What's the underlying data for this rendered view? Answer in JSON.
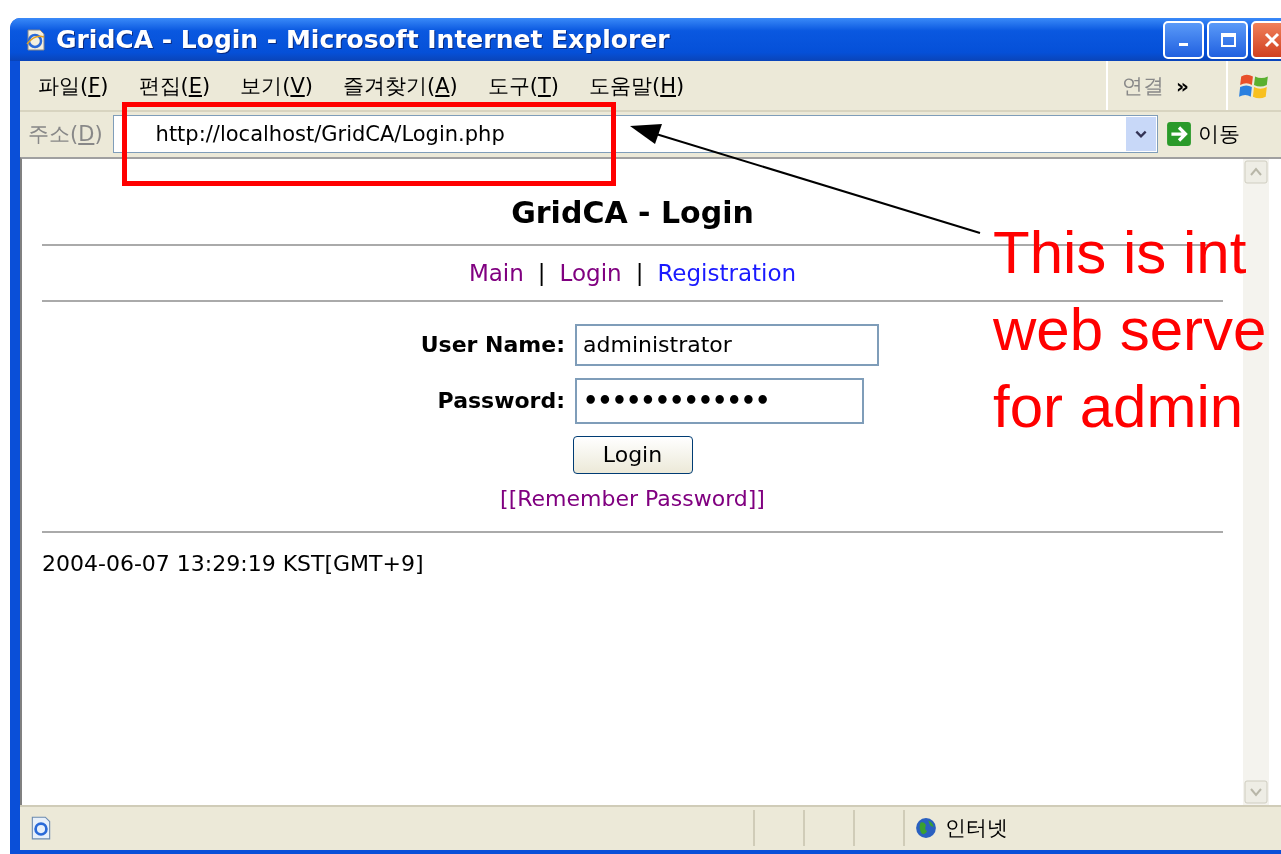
{
  "window": {
    "title": "GridCA - Login - Microsoft Internet Explorer"
  },
  "menu": [
    {
      "before": "파일(",
      "key": "F",
      "after": ")"
    },
    {
      "before": "편집(",
      "key": "E",
      "after": ")"
    },
    {
      "before": "보기(",
      "key": "V",
      "after": ")"
    },
    {
      "before": "즐겨찾기(",
      "key": "A",
      "after": ")"
    },
    {
      "before": "도구(",
      "key": "T",
      "after": ")"
    },
    {
      "before": "도움말(",
      "key": "H",
      "after": ")"
    }
  ],
  "links_toolbar": {
    "label": "연결",
    "chevron": "»"
  },
  "address_bar": {
    "before": "주소(",
    "key": "D",
    "after": ")",
    "url": "http://localhost/GridCA/Login.php",
    "go_label": "이동"
  },
  "page": {
    "heading": "GridCA - Login",
    "nav": [
      {
        "kind": "link",
        "label": "Main",
        "visited": true
      },
      {
        "kind": "separator",
        "label": "|"
      },
      {
        "kind": "link",
        "label": "Login",
        "visited": true
      },
      {
        "kind": "separator",
        "label": "|"
      },
      {
        "kind": "link",
        "label": "Registration",
        "visited": false
      }
    ],
    "fields": [
      {
        "kind": "text",
        "label": "User Name:",
        "value": "administrator"
      },
      {
        "kind": "password",
        "label": "Password:",
        "value": "•••••••••••••"
      }
    ],
    "submit": "Login",
    "link": {
      "label": "[[Remember Password]]",
      "visited": true
    },
    "timestamp": "2004-06-07 13:29:19 KST[GMT+9]"
  },
  "status_bar": {
    "zone": "인터넷"
  },
  "annotation": {
    "lines": [
      "This is int",
      "web serve",
      "for admin"
    ]
  }
}
